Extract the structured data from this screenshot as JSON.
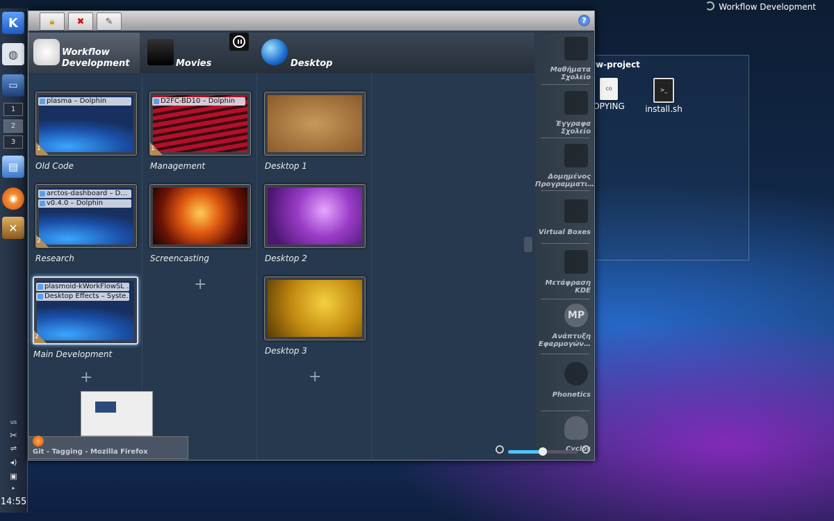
{
  "top_title": "Workflow Development",
  "folderview": {
    "title": "w-project",
    "icons": [
      {
        "label": "OPYING",
        "glyph": "co"
      },
      {
        "label": "install.sh",
        "glyph": ">_"
      }
    ]
  },
  "pager": [
    "1",
    "2",
    "3"
  ],
  "tray": {
    "keyboard": "us",
    "clock": "14:55"
  },
  "columns": [
    {
      "title_line1": "Workflow",
      "title_line2": "Development"
    },
    {
      "title_line1": "Movies"
    },
    {
      "title_line1": "Desktop"
    }
  ],
  "cards": {
    "old_code": {
      "label": "Old Code",
      "windows": [
        "plasma – Dolphin"
      ],
      "count": "1"
    },
    "research": {
      "label": "Research",
      "windows": [
        "arctos-dashboard – D…",
        "v0.4.0 – Dolphin"
      ],
      "count": "2"
    },
    "main_dev": {
      "label": "Main Development",
      "windows": [
        "plasmoid-kWorkFlowSL …",
        "Desktop Effects – Syste…"
      ],
      "count": "2"
    },
    "management": {
      "label": "Management",
      "windows": [
        "D2FC-BD10 – Dolphin"
      ],
      "count": "1"
    },
    "screencasting": {
      "label": "Screencasting"
    },
    "desktop1": {
      "label": "Desktop 1"
    },
    "desktop2": {
      "label": "Desktop 2"
    },
    "desktop3": {
      "label": "Desktop 3"
    }
  },
  "sidebar": [
    {
      "line1": "Μαθήματα",
      "line2": "Σχολείο"
    },
    {
      "line1": "Έγγραφα",
      "line2": "Σχολείο"
    },
    {
      "line1": "Δομημένος",
      "line2": "Προγραμματι…"
    },
    {
      "line1": "Virtual Boxes",
      "line2": ""
    },
    {
      "line1": "Μετάφραση",
      "line2": "KDE"
    },
    {
      "line1": "Ανάπτυξη",
      "line2": "Εφαρμογών…"
    },
    {
      "line1": "Phonetics",
      "line2": ""
    },
    {
      "line1": "Cyclos",
      "line2": ""
    }
  ],
  "task": {
    "label": "Git - Tagging - Mozilla Firefox"
  },
  "zoom": {
    "level": 0.5
  }
}
